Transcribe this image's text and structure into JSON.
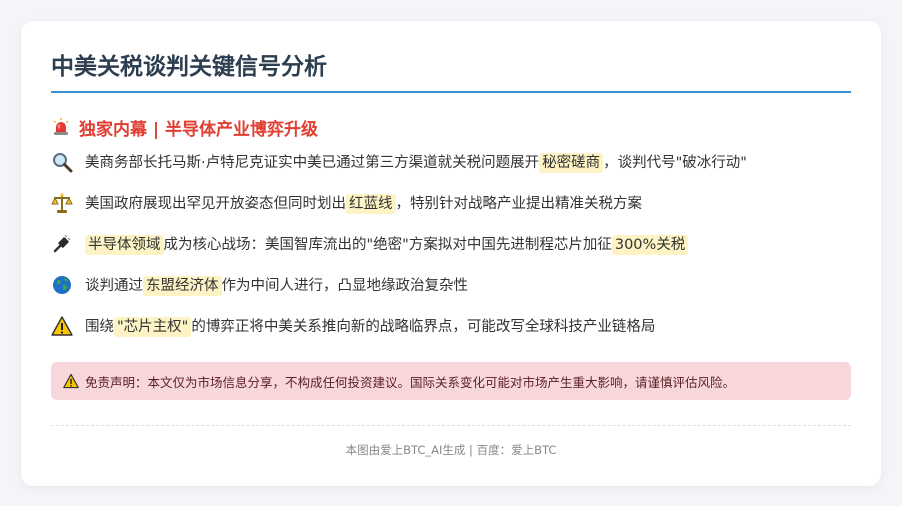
{
  "title": "中美关税谈判关键信号分析",
  "section": {
    "icon": "siren-icon",
    "heading": "独家内幕 | 半导体产业博弈升级"
  },
  "items": [
    {
      "icon": "magnifier-icon",
      "pre": "美商务部长托马斯·卢特尼克证实中美已通过第三方渠道就关税问题展开",
      "hl": "秘密磋商",
      "post": "，谈判代号\"破冰行动\""
    },
    {
      "icon": "balance-scale-icon",
      "pre": "美国政府展现出罕见开放姿态但同时划出",
      "hl": "红蓝线",
      "post": "，特别针对战略产业提出精准关税方案"
    },
    {
      "icon": "chip-icon",
      "hl": "半导体领域",
      "mid": "成为核心战场：美国智库流出的\"绝密\"方案拟对中国先进制程芯片加征",
      "hl2": "300%关税"
    },
    {
      "icon": "globe-icon",
      "pre": "谈判通过",
      "hl": "东盟经济体",
      "post": "作为中间人进行，凸显地缘政治复杂性"
    },
    {
      "icon": "warning-icon",
      "pre": "围绕",
      "hl": "\"芯片主权\"",
      "post": "的博弈正将中美关系推向新的战略临界点，可能改写全球科技产业链格局"
    }
  ],
  "disclaimer": {
    "icon": "warning-icon",
    "text": "免责声明：本文仅为市场信息分享，不构成任何投资建议。国际关系变化可能对市场产生重大影响，请谨慎评估风险。"
  },
  "footer": "本图由爱上BTC_AI生成 | 百度：爱上BTC",
  "colors": {
    "accent": "#3b8fd4",
    "heading_red": "#e03e32",
    "highlight": "#fdf3c4",
    "disclaimer_bg": "#f8d7da"
  }
}
